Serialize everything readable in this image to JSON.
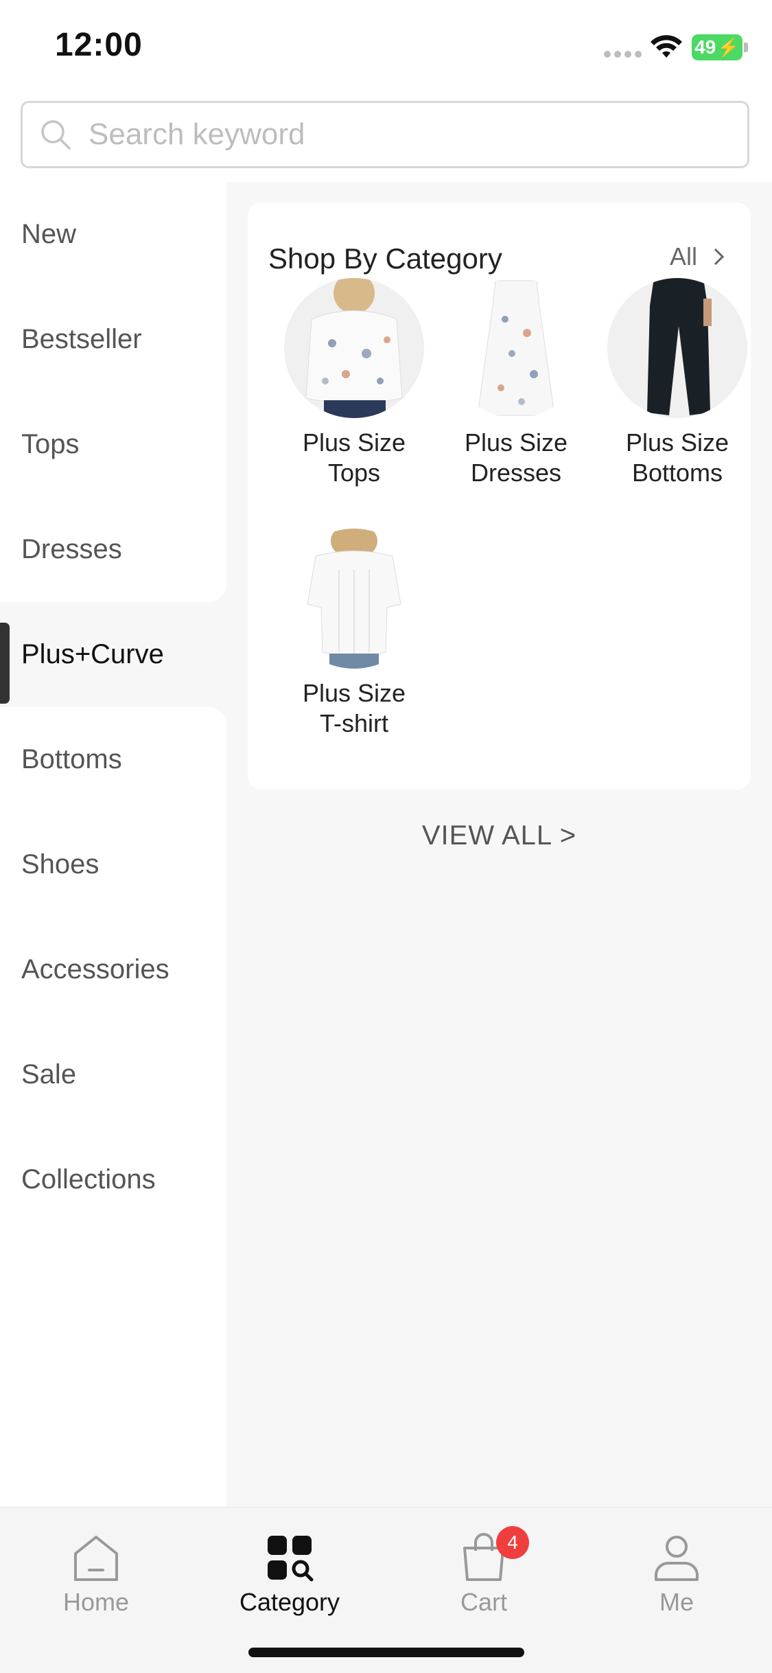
{
  "status_bar": {
    "time": "12:00",
    "battery": "49"
  },
  "search": {
    "placeholder": "Search keyword",
    "icon": "search-icon"
  },
  "sidebar": {
    "items": [
      {
        "label": "New"
      },
      {
        "label": "Bestseller"
      },
      {
        "label": "Tops"
      },
      {
        "label": "Dresses"
      },
      {
        "label": "Plus+Curve"
      },
      {
        "label": "Bottoms"
      },
      {
        "label": "Shoes"
      },
      {
        "label": "Accessories"
      },
      {
        "label": "Sale"
      },
      {
        "label": "Collections"
      }
    ],
    "active_label": "Plus+Curve"
  },
  "main": {
    "card": {
      "title": "Shop By Category",
      "all_label": "All",
      "products": [
        {
          "name_line1": "Plus Size",
          "name_line2": "Tops"
        },
        {
          "name_line1": "Plus Size",
          "name_line2": "Dresses"
        },
        {
          "name_line1": "Plus Size",
          "name_line2": "Bottoms"
        },
        {
          "name_line1": "Plus Size",
          "name_line2": "T-shirt"
        }
      ]
    },
    "view_all_label": "VIEW ALL >"
  },
  "tab_bar": {
    "tabs": [
      {
        "label": "Home",
        "icon": "home-icon"
      },
      {
        "label": "Category",
        "icon": "category-icon"
      },
      {
        "label": "Cart",
        "icon": "cart-icon"
      },
      {
        "label": "Me",
        "icon": "profile-icon"
      }
    ],
    "active_tab": "Category",
    "cart_badge": "4"
  },
  "colors": {
    "badge": "#f03e3e",
    "battery": "#4cd964",
    "active_text": "#111111",
    "inactive_text": "#999999"
  }
}
